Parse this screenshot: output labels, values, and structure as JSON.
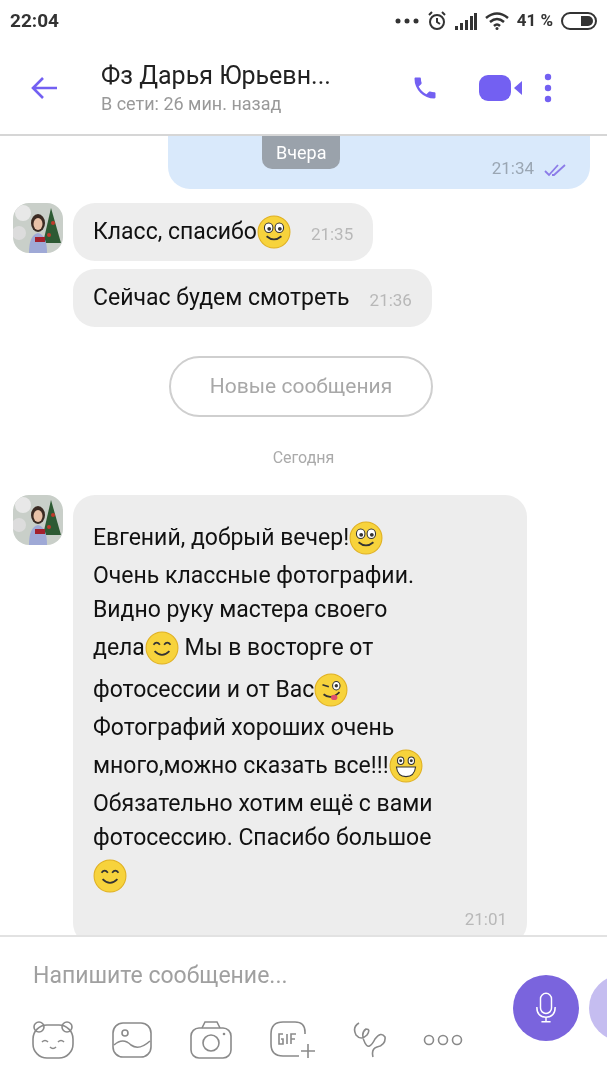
{
  "status_bar": {
    "time": "22:04",
    "battery_text": "41 %"
  },
  "header": {
    "title": "Фз Дарья Юрьевн...",
    "subtitle": "В сети: 26 мин. назад"
  },
  "date_pill": "Вчера",
  "outgoing": {
    "time": "21:34",
    "read": true
  },
  "messages": [
    {
      "lines": [
        [
          {
            "kind": "text",
            "text": "Класс, спасибо"
          },
          {
            "kind": "smile"
          }
        ]
      ],
      "time": "21:35",
      "avatar": true
    },
    {
      "lines": [
        [
          {
            "kind": "text",
            "text": "Сейчас будем смотреть"
          }
        ]
      ],
      "time": "21:36",
      "avatar": false
    }
  ],
  "new_messages_button": "Новые сообщения",
  "day_label": "Сегодня",
  "long_message": {
    "avatar": true,
    "time": "21:01",
    "lines": [
      [
        {
          "kind": "text",
          "text": "Евгений, добрый вечер!"
        },
        {
          "kind": "smile"
        }
      ],
      [
        {
          "kind": "text",
          "text": "Очень классные фотографии."
        }
      ],
      [
        {
          "kind": "text",
          "text": "Видно руку мастера своего"
        }
      ],
      [
        {
          "kind": "text",
          "text": "дела"
        },
        {
          "kind": "happy"
        },
        {
          "kind": "text",
          "text": " Мы в восторге от"
        }
      ],
      [
        {
          "kind": "text",
          "text": "фотосессии и от Вас"
        },
        {
          "kind": "wink"
        }
      ],
      [
        {
          "kind": "text",
          "text": "Фотографий хороших очень"
        }
      ],
      [
        {
          "kind": "text",
          "text": "много,можно сказать все!!!"
        },
        {
          "kind": "grin"
        }
      ],
      [
        {
          "kind": "text",
          "text": "Обязательно хотим ещё с вами"
        }
      ],
      [
        {
          "kind": "text",
          "text": "фотосессию. Спасибо большое"
        }
      ],
      [
        {
          "kind": "happy"
        }
      ]
    ]
  },
  "composer": {
    "placeholder": "Напишите сообщение..."
  }
}
